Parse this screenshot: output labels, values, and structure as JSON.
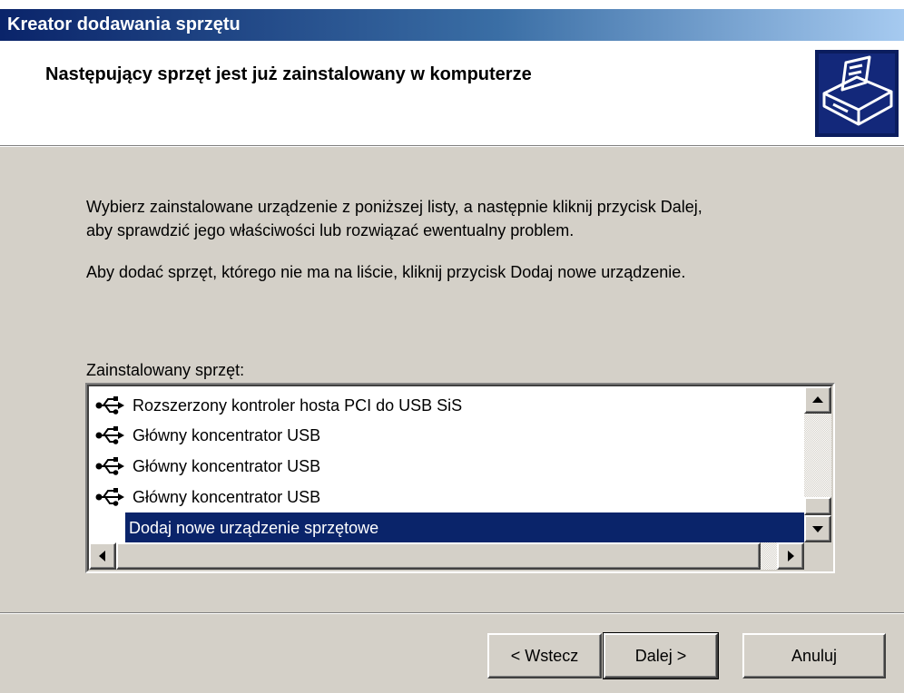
{
  "window": {
    "title": "Kreator dodawania sprzętu"
  },
  "header": {
    "title": "Następujący sprzęt jest już zainstalowany w komputerze",
    "icon": "hardware-wizard-icon"
  },
  "body": {
    "paragraph1_line1": "Wybierz zainstalowane urządzenie z poniższej listy, a następnie kliknij przycisk Dalej,",
    "paragraph1_line2": "aby sprawdzić jego właściwości lub rozwiązać ewentualny problem.",
    "paragraph2": "Aby dodać sprzęt, którego nie ma na liście, kliknij przycisk Dodaj nowe urządzenie.",
    "list_label": "Zainstalowany sprzęt:"
  },
  "hardware_list": {
    "items": [
      {
        "label": "Rozszerzony kontroler hosta PCI do USB SiS",
        "icon": "usb-icon",
        "selected": false
      },
      {
        "label": "Główny koncentrator USB",
        "icon": "usb-icon",
        "selected": false
      },
      {
        "label": "Główny koncentrator USB",
        "icon": "usb-icon",
        "selected": false
      },
      {
        "label": "Główny koncentrator USB",
        "icon": "usb-icon",
        "selected": false
      },
      {
        "label": "Dodaj nowe urządzenie sprzętowe",
        "icon": null,
        "selected": true
      }
    ]
  },
  "buttons": {
    "back": "< Wstecz",
    "next": "Dalej >",
    "cancel": "Anuluj"
  },
  "colors": {
    "titlebar_start": "#0a246a",
    "titlebar_end": "#a6caf0",
    "dialog_face": "#d4d0c8",
    "selection": "#0a246a"
  }
}
